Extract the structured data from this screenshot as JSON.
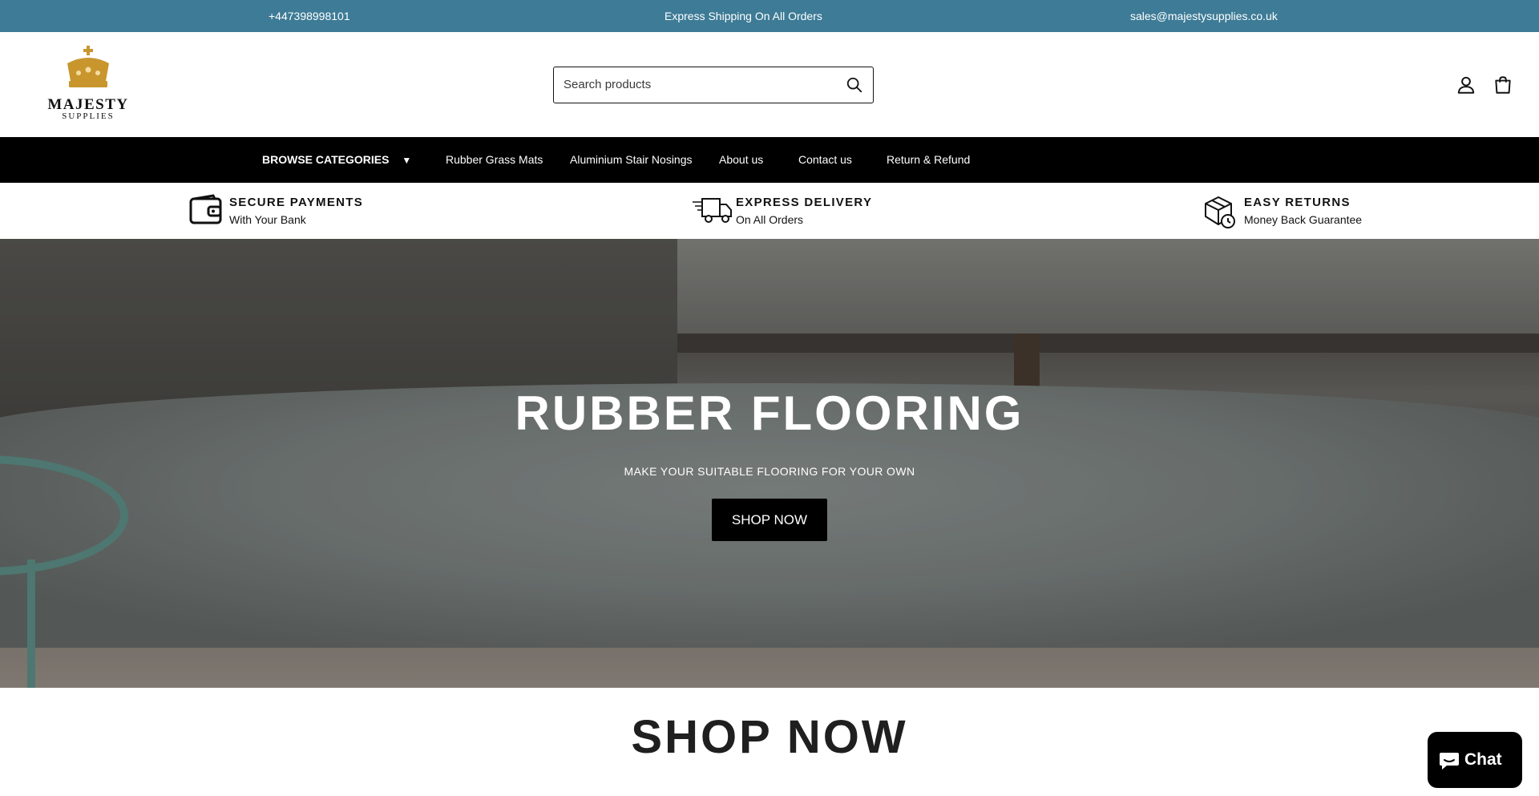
{
  "topbar": {
    "phone": "+447398998101",
    "announcement": "Express Shipping On All Orders",
    "email": "sales@majestysupplies.co.uk"
  },
  "logo": {
    "name": "MAJESTY",
    "sub": "SUPPLIES"
  },
  "search": {
    "placeholder": "Search products"
  },
  "header_icons": [
    "account-icon",
    "cart-icon",
    "search-icon"
  ],
  "nav": {
    "browse": "BROWSE CATEGORIES",
    "browse_arrow": "▼",
    "items": [
      {
        "label": "Rubber Grass Mats"
      },
      {
        "label": "Aluminium Stair Nosings"
      },
      {
        "label": "About us"
      },
      {
        "label": "Contact us"
      },
      {
        "label": "Return & Refund"
      }
    ]
  },
  "features": [
    {
      "title": "SECURE PAYMENTS",
      "subtitle": "With Your Bank",
      "icon": "wallet-icon"
    },
    {
      "title": "EXPRESS DELIVERY",
      "subtitle": "On All Orders",
      "icon": "truck-icon"
    },
    {
      "title": "EASY RETURNS",
      "subtitle": "Money Back Guarantee",
      "icon": "box-return-icon"
    }
  ],
  "hero": {
    "title": "RUBBER FLOORING",
    "subtitle": "MAKE YOUR SUITABLE FLOORING FOR YOUR OWN",
    "button": "SHOP NOW"
  },
  "section": {
    "title": "SHOP NOW"
  },
  "chat": {
    "label": "Chat"
  },
  "colors": {
    "topbar": "#3d7b96",
    "nav": "#000000",
    "logo_gold": "#c9962e"
  }
}
